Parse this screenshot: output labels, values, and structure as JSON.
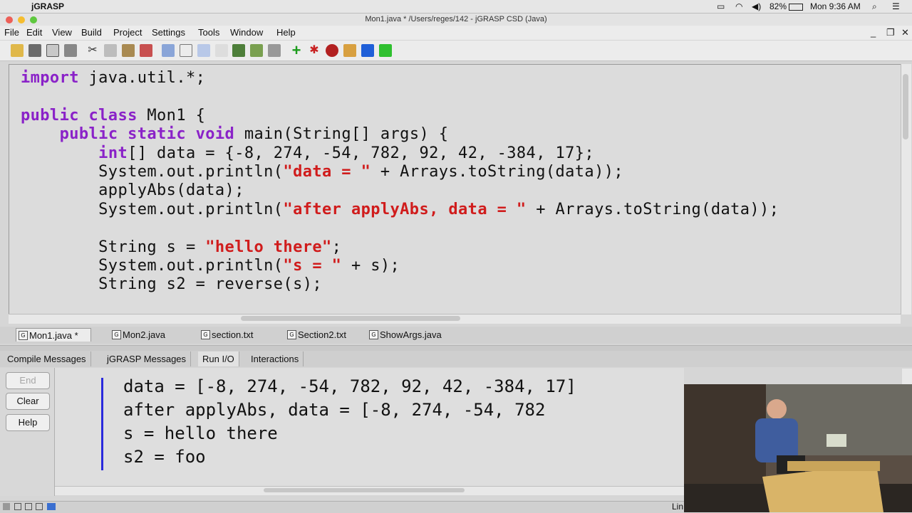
{
  "macbar": {
    "app_name": "jGRASP",
    "battery": "82%",
    "clock": "Mon 9:36 AM"
  },
  "window": {
    "title": "Mon1.java * /Users/reges/142 - jGRASP CSD (Java)"
  },
  "menu": [
    "File",
    "Edit",
    "View",
    "Build",
    "Project",
    "Settings",
    "Tools",
    "Window",
    "Help"
  ],
  "editor": {
    "lines": [
      [
        [
          "kw",
          "import"
        ],
        [
          "t",
          " java.util.*;"
        ]
      ],
      [
        [
          "t",
          ""
        ]
      ],
      [
        [
          "kw",
          "public class"
        ],
        [
          "t",
          " Mon1 {"
        ]
      ],
      [
        [
          "t",
          "    "
        ],
        [
          "kw",
          "public static void"
        ],
        [
          "t",
          " main(String[] args) {"
        ]
      ],
      [
        [
          "t",
          "        "
        ],
        [
          "kw",
          "int"
        ],
        [
          "t",
          "[] data = {-8, 274, -54, 782, 92, 42, -384, 17};"
        ]
      ],
      [
        [
          "t",
          "        System.out.println("
        ],
        [
          "str",
          "\"data = \""
        ],
        [
          "t",
          " + Arrays.toString(data));"
        ]
      ],
      [
        [
          "t",
          "        applyAbs(data);"
        ]
      ],
      [
        [
          "t",
          "        System.out.println("
        ],
        [
          "str",
          "\"after applyAbs, data = \""
        ],
        [
          "t",
          " + Arrays.toString(data));"
        ]
      ],
      [
        [
          "t",
          ""
        ]
      ],
      [
        [
          "t",
          "        String s = "
        ],
        [
          "str",
          "\"hello there\""
        ],
        [
          "t",
          ";"
        ]
      ],
      [
        [
          "t",
          "        System.out.println("
        ],
        [
          "str",
          "\"s = \""
        ],
        [
          "t",
          " + s);"
        ]
      ],
      [
        [
          "t",
          "        String s2 = reverse(s);"
        ]
      ]
    ]
  },
  "file_tabs": [
    "Mon1.java *",
    "Mon2.java",
    "section.txt",
    "Section2.txt",
    "ShowArgs.java"
  ],
  "message_tabs": [
    "Compile Messages",
    "jGRASP Messages",
    "Run I/O",
    "Interactions"
  ],
  "run_buttons": {
    "end": "End",
    "clear": "Clear",
    "help": "Help"
  },
  "run_output": [
    "data = [-8, 274, -54, 782, 92, 42, -384, 17]",
    "after applyAbs, data = [-8, 274, -54, 782",
    "s = hello there",
    "s2 = foo"
  ],
  "statusbar": {
    "line_label": "Lin"
  },
  "colors": {
    "keyword": "#8a22c8",
    "string": "#d01c1c",
    "io_marker": "#2a2adc"
  }
}
